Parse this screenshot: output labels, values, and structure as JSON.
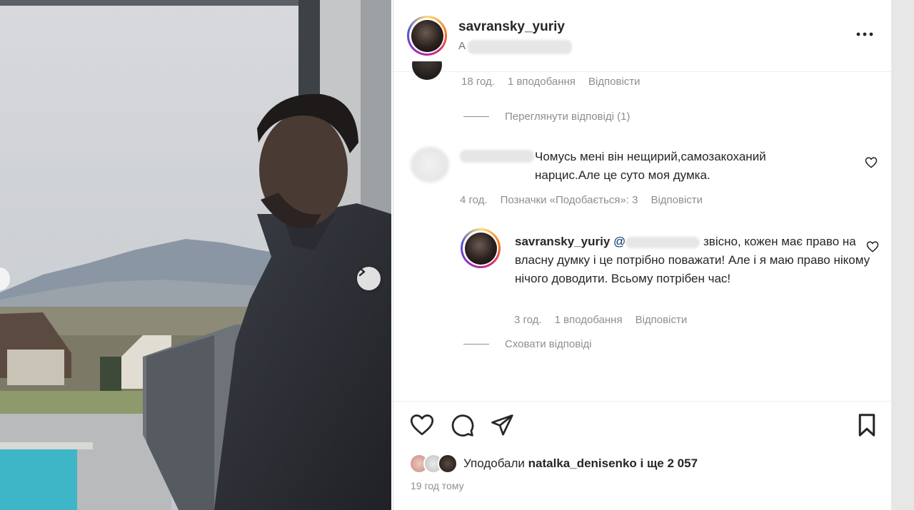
{
  "post": {
    "username": "savransky_yuriy",
    "subtitle": "A"
  },
  "thread": {
    "prev_comment_meta": {
      "time": "18 год.",
      "likes": "1 вподобання",
      "reply": "Відповісти"
    },
    "view_replies": "Переглянути відповіді (1)",
    "comment": {
      "text": "Чомусь мені він нещирий,самозакоханий нарцис.Але це суто моя думка.",
      "time": "4 год.",
      "tagged": "Позначки «Подобається»: 3",
      "reply": "Відповісти"
    },
    "reply": {
      "username": "savransky_yuriy",
      "mention": "@",
      "text": "звісно, кожен має право на власну думку і це потрібно поважати! Але і я маю право нікому нічого доводити. Всьому потрібен час!",
      "time": "3 год.",
      "likes": "1 вподобання",
      "reply": "Відповісти"
    },
    "hide_replies": "Сховати відповіді"
  },
  "footer": {
    "liked_prefix": "Уподобали",
    "liked_user": "natalka_denisenko",
    "liked_suffix": "і ще 2 057",
    "time_ago": "19 год тому"
  },
  "icons": {
    "like": "heart-icon",
    "comment": "comment-icon",
    "share": "send-icon",
    "save": "bookmark-icon",
    "more": "more-options-icon",
    "next": "chevron-right-icon"
  }
}
